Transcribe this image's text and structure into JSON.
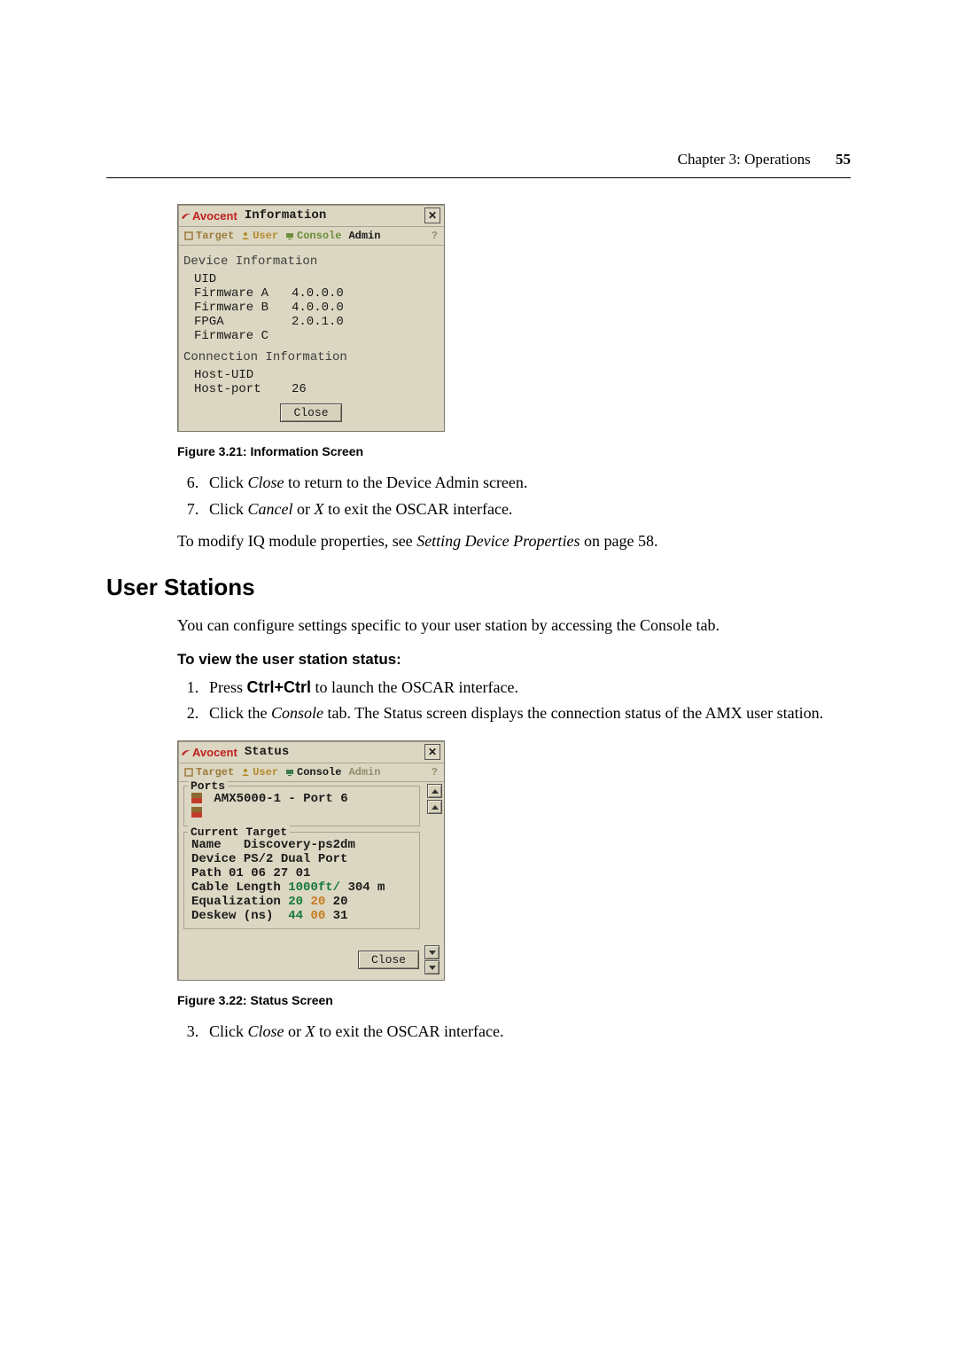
{
  "header": {
    "chapter": "Chapter 3: Operations",
    "page": "55"
  },
  "fig1": {
    "caption": "Figure 3.21: Information Screen",
    "brand": "Avocent",
    "title": "Information",
    "tabs": {
      "target": "Target",
      "user": "User",
      "console": "Console",
      "admin": "Admin",
      "help": "?"
    },
    "device_section": "Device Information",
    "rows": {
      "uid_label": "UID",
      "fwA_label": "Firmware A",
      "fwA_val": "4.0.0.0",
      "fwB_label": "Firmware B",
      "fwB_val": "4.0.0.0",
      "fpga_label": "FPGA",
      "fpga_val": "2.0.1.0",
      "fwC_label": "Firmware C"
    },
    "conn_section": "Connection Information",
    "conn": {
      "hostuid_label": "Host-UID",
      "hostport_label": "Host-port",
      "hostport_val": "26"
    },
    "close": "Close"
  },
  "steps1": {
    "s6a": "Click ",
    "s6b": "Close",
    "s6c": " to return to the Device Admin screen.",
    "s7a": "Click ",
    "s7b": "Cancel",
    "s7c": " or ",
    "s7d": "X",
    "s7e": " to exit the OSCAR interface."
  },
  "modify_line": {
    "a": "To modify IQ module properties, see ",
    "b": "Setting Device Properties",
    "c": " on page 58."
  },
  "section_title": "User Stations",
  "intro": "You can configure settings specific to your user station by accessing the Console tab.",
  "subhead": "To view the user station status:",
  "steps2": {
    "s1a": "Press ",
    "s1b": "Ctrl+Ctrl",
    "s1c": " to launch the OSCAR interface.",
    "s2a": "Click the ",
    "s2b": "Console",
    "s2c": " tab. The Status screen displays the connection status of the AMX user station."
  },
  "fig2": {
    "caption": "Figure 3.22: Status Screen",
    "brand": "Avocent",
    "title": "Status",
    "tabs": {
      "target": "Target",
      "user": "User",
      "console": "Console",
      "admin": "Admin",
      "help": "?"
    },
    "ports_legend": "Ports",
    "ports_line": "AMX5000-1 - Port 6",
    "ct_legend": "Current Target",
    "rows": {
      "name_l": "Name",
      "name_v": "Discovery-ps2dm",
      "dev_l": "Device",
      "dev_v": "PS/2 Dual Port",
      "path_l": "Path",
      "path_v": "01 06 27 01",
      "cl_l": "Cable Length",
      "cl_v1": "1000ft/",
      "cl_v2": " 304 m",
      "eq_l": "Equalization",
      "eq_v1": "20",
      "eq_v2": "20",
      "eq_v3": "20",
      "dk_l": "Deskew (ns)",
      "dk_v1": "44",
      "dk_v2": "00",
      "dk_v3": "31"
    },
    "close": "Close"
  },
  "steps3": {
    "s3a": "Click ",
    "s3b": "Close",
    "s3c": " or ",
    "s3d": "X",
    "s3e": " to exit the OSCAR interface."
  }
}
